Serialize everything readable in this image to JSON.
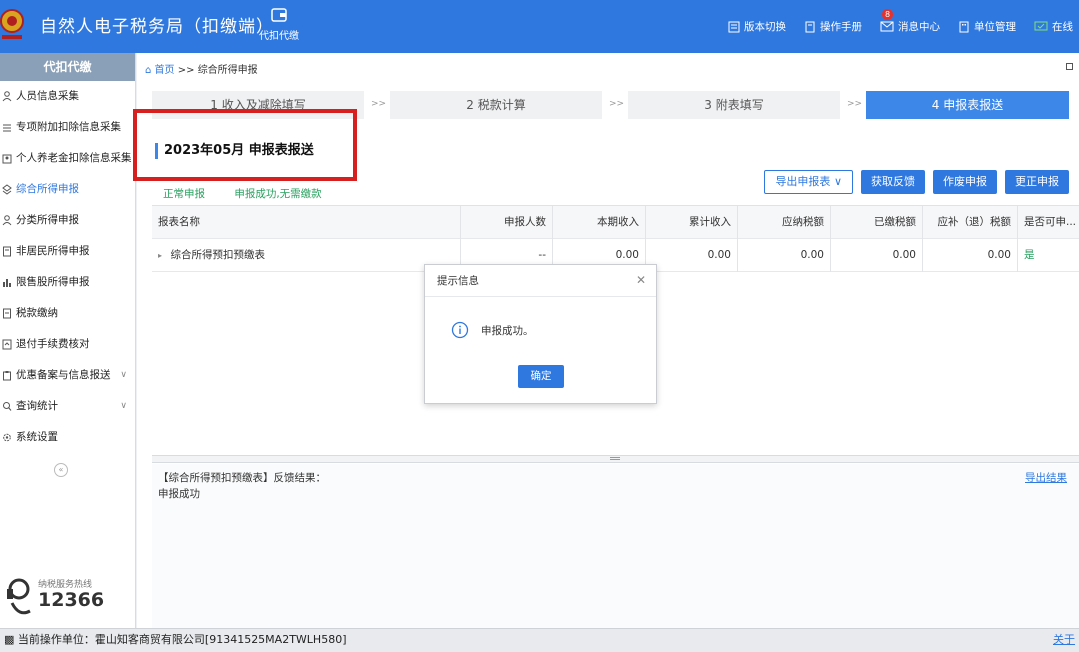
{
  "header": {
    "title": "自然人电子税务局（扣缴端）",
    "agent_button": "代扣代缴",
    "right_items": [
      {
        "label": "版本切换",
        "icon": "version-switch-icon"
      },
      {
        "label": "操作手册",
        "icon": "manual-icon"
      },
      {
        "label": "消息中心",
        "icon": "message-icon",
        "badge": "8"
      },
      {
        "label": "单位管理",
        "icon": "building-icon"
      },
      {
        "label": "在线",
        "icon": "online-icon"
      }
    ]
  },
  "sidebar": {
    "heading": "代扣代缴",
    "items": [
      {
        "label": "人员信息采集"
      },
      {
        "label": "专项附加扣除信息采集"
      },
      {
        "label": "个人养老金扣除信息采集"
      },
      {
        "label": "综合所得申报"
      },
      {
        "label": "分类所得申报"
      },
      {
        "label": "非居民所得申报"
      },
      {
        "label": "限售股所得申报"
      },
      {
        "label": "税款缴纳"
      },
      {
        "label": "退付手续费核对"
      },
      {
        "label": "优惠备案与信息报送"
      },
      {
        "label": "查询统计"
      },
      {
        "label": "系统设置"
      }
    ],
    "hotline_label": "纳税服务热线",
    "hotline_number": "12366"
  },
  "breadcrumb": {
    "home": "首页",
    "sep": ">>",
    "current": "综合所得申报"
  },
  "steps": [
    {
      "label": "1 收入及减除填写"
    },
    {
      "label": "2 税款计算"
    },
    {
      "label": "3 附表填写"
    },
    {
      "label": "4 申报表报送"
    }
  ],
  "step_sep": ">>",
  "section_title": "2023年05月  申报表报送",
  "sub_tabs": [
    "正常申报",
    "申报成功,无需缴款"
  ],
  "actions": {
    "export": "导出申报表",
    "feedback": "获取反馈",
    "void": "作废申报",
    "correct": "更正申报"
  },
  "table": {
    "headers": [
      "报表名称",
      "申报人数",
      "本期收入",
      "累计收入",
      "应纳税额",
      "已缴税额",
      "应补（退）税额",
      "是否可申..."
    ],
    "rows": [
      {
        "name": "综合所得预扣预缴表",
        "count": "--",
        "current_income": "0.00",
        "total_income": "0.00",
        "tax_payable": "0.00",
        "tax_paid": "0.00",
        "tax_due": "0.00",
        "can_declare": "是"
      }
    ]
  },
  "result": {
    "title": "【综合所得预扣预缴表】反馈结果：",
    "body": "申报成功",
    "export_link": "导出结果"
  },
  "dialog": {
    "title": "提示信息",
    "message": "申报成功。",
    "ok": "确定"
  },
  "statusbar": {
    "text": "当前操作单位：霍山知客商贸有限公司[91341525MA2TWLH580]",
    "link": "关于"
  },
  "colors": {
    "primary": "#2f78e0",
    "highlight": "#d71f1f",
    "success": "#2aa060"
  }
}
